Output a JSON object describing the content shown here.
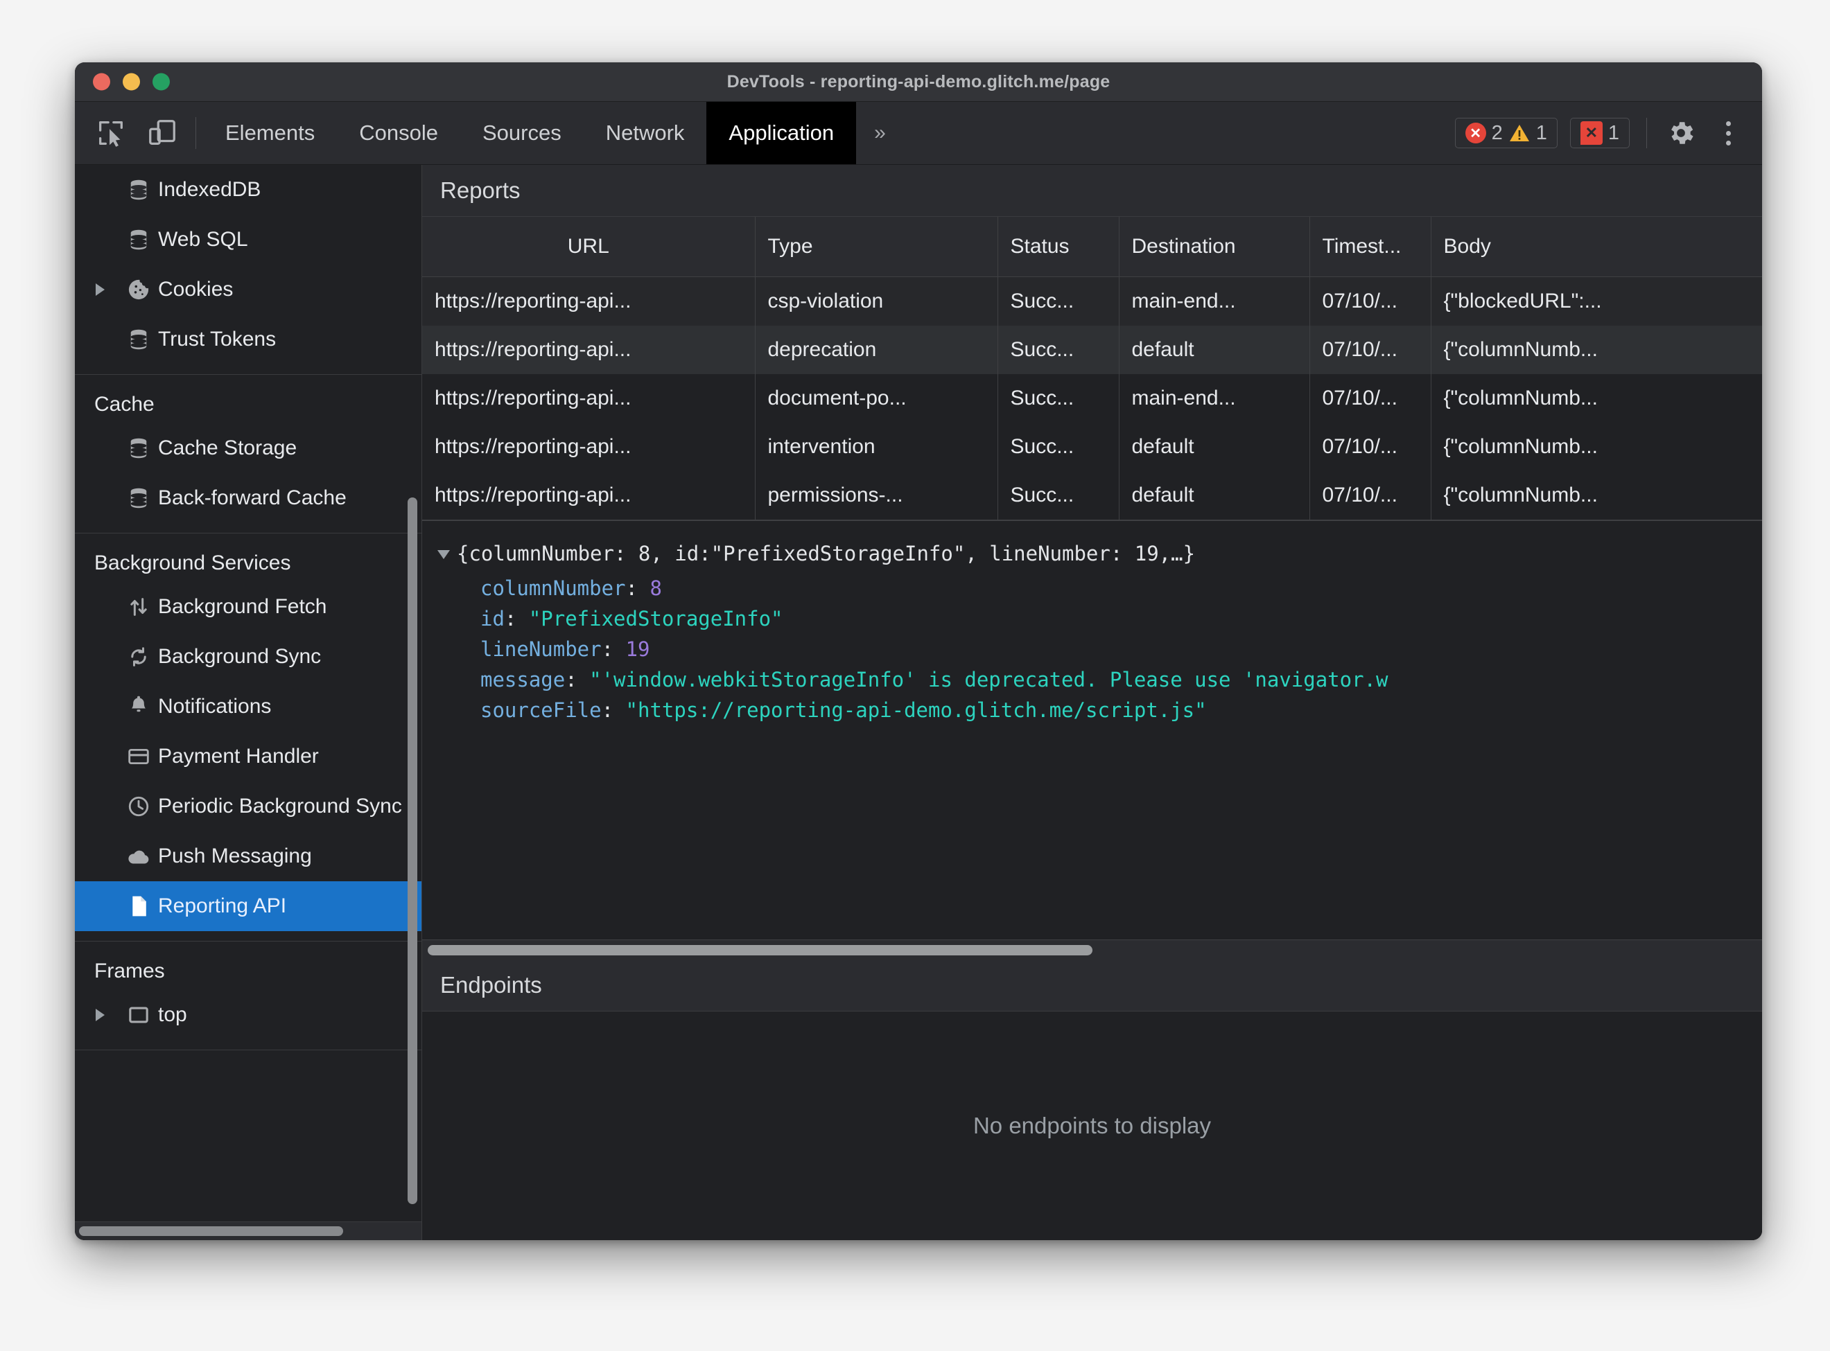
{
  "window": {
    "title": "DevTools - reporting-api-demo.glitch.me/page"
  },
  "toolbar": {
    "inspect_icon": "inspect-cursor-icon",
    "device_icon": "device-toolbar-icon",
    "tabs": [
      {
        "label": "Elements",
        "active": false
      },
      {
        "label": "Console",
        "active": false
      },
      {
        "label": "Sources",
        "active": false
      },
      {
        "label": "Network",
        "active": false
      },
      {
        "label": "Application",
        "active": true
      }
    ],
    "more_tabs_label": "»",
    "error_count": "2",
    "warning_count": "1",
    "issue_count": "1",
    "settings_icon": "gear-icon",
    "menu_icon": "kebab-menu-icon"
  },
  "sidebar": {
    "groups": [
      {
        "header": null,
        "items": [
          {
            "label": "IndexedDB",
            "icon": "database-icon",
            "arrow": false,
            "selected": false
          },
          {
            "label": "Web SQL",
            "icon": "database-icon",
            "arrow": false,
            "selected": false
          },
          {
            "label": "Cookies",
            "icon": "cookie-icon",
            "arrow": true,
            "selected": false
          },
          {
            "label": "Trust Tokens",
            "icon": "database-icon",
            "arrow": false,
            "selected": false
          }
        ]
      },
      {
        "header": "Cache",
        "items": [
          {
            "label": "Cache Storage",
            "icon": "database-icon",
            "arrow": false,
            "selected": false
          },
          {
            "label": "Back-forward Cache",
            "icon": "database-icon",
            "arrow": false,
            "selected": false
          }
        ]
      },
      {
        "header": "Background Services",
        "items": [
          {
            "label": "Background Fetch",
            "icon": "updown-arrows-icon",
            "arrow": false,
            "selected": false
          },
          {
            "label": "Background Sync",
            "icon": "sync-icon",
            "arrow": false,
            "selected": false
          },
          {
            "label": "Notifications",
            "icon": "bell-icon",
            "arrow": false,
            "selected": false
          },
          {
            "label": "Payment Handler",
            "icon": "credit-card-icon",
            "arrow": false,
            "selected": false
          },
          {
            "label": "Periodic Background Sync",
            "icon": "clock-icon",
            "arrow": false,
            "selected": false
          },
          {
            "label": "Push Messaging",
            "icon": "cloud-icon",
            "arrow": false,
            "selected": false
          },
          {
            "label": "Reporting API",
            "icon": "document-icon",
            "arrow": false,
            "selected": true
          }
        ]
      },
      {
        "header": "Frames",
        "items": [
          {
            "label": "top",
            "icon": "frame-icon",
            "arrow": true,
            "selected": false
          }
        ]
      }
    ]
  },
  "reports": {
    "title": "Reports",
    "columns": [
      "URL",
      "Type",
      "Status",
      "Destination",
      "Timest...",
      "Body"
    ],
    "rows": [
      {
        "url": "https://reporting-api...",
        "type": "csp-violation",
        "status": "Succ...",
        "destination": "main-end...",
        "timestamp": "07/10/...",
        "body": "{\"blockedURL\":..."
      },
      {
        "url": "https://reporting-api...",
        "type": "deprecation",
        "status": "Succ...",
        "destination": "default",
        "timestamp": "07/10/...",
        "body": "{\"columnNumb..."
      },
      {
        "url": "https://reporting-api...",
        "type": "document-po...",
        "status": "Succ...",
        "destination": "main-end...",
        "timestamp": "07/10/...",
        "body": "{\"columnNumb..."
      },
      {
        "url": "https://reporting-api...",
        "type": "intervention",
        "status": "Succ...",
        "destination": "default",
        "timestamp": "07/10/...",
        "body": "{\"columnNumb..."
      },
      {
        "url": "https://reporting-api...",
        "type": "permissions-...",
        "status": "Succ...",
        "destination": "default",
        "timestamp": "07/10/...",
        "body": "{\"columnNumb..."
      }
    ]
  },
  "report_detail": {
    "summary_prefix": "{columnNumber: 8, id: ",
    "summary_id": "\"PrefixedStorageInfo\"",
    "summary_suffix": ", lineNumber: 19,…}",
    "rows": [
      {
        "key": "columnNumber",
        "value": "8",
        "kind": "number"
      },
      {
        "key": "id",
        "value": "\"PrefixedStorageInfo\"",
        "kind": "string"
      },
      {
        "key": "lineNumber",
        "value": "19",
        "kind": "number"
      },
      {
        "key": "message",
        "value": "\"'window.webkitStorageInfo' is deprecated. Please use 'navigator.w",
        "kind": "string"
      },
      {
        "key": "sourceFile",
        "value": "\"https://reporting-api-demo.glitch.me/script.js\"",
        "kind": "string"
      }
    ]
  },
  "endpoints": {
    "title": "Endpoints",
    "empty_message": "No endpoints to display"
  },
  "colors": {
    "accent_selected": "#1a73c8",
    "error_red": "#e5453a",
    "warning_yellow": "#f2b233",
    "json_key": "#74b0e0",
    "json_string": "#2dd4bf",
    "json_number": "#9a7bdc",
    "panel_bg": "#202124",
    "header_bg": "#2b2c30"
  }
}
